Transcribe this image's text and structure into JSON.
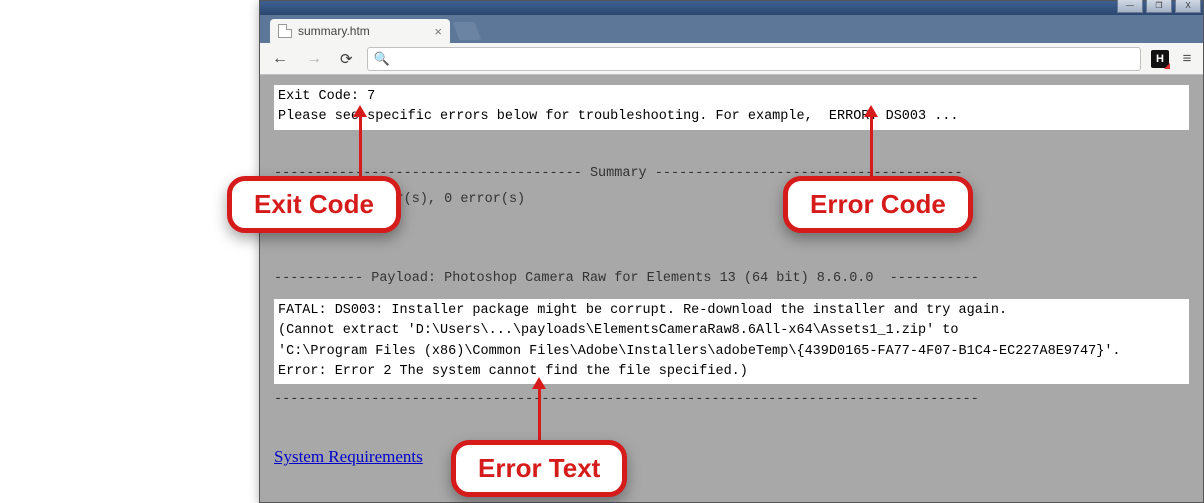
{
  "window": {
    "minimize": "—",
    "maximize": "❐",
    "close": "X"
  },
  "tab": {
    "title": "summary.htm",
    "close": "×"
  },
  "toolbar": {
    "back": "←",
    "forward": "→",
    "reload": "⟳",
    "search_icon": "🔍",
    "omnibox_value": "",
    "ext_label": "H",
    "menu": "≡"
  },
  "content": {
    "exit_line": "Exit Code: 7",
    "advice_line": "Please see specific errors below for troubleshooting. For example,  ERROR: DS003 ...",
    "blank_gap1": " ",
    "summary_sep": "-------------------------------------- Summary --------------------------------------",
    "counts_line": " - 2 fatal error(s), 0 error(s)",
    "blank_gap2": " ",
    "blank_gap3": " ",
    "payload_sep": "----------- Payload: Photoshop Camera Raw for Elements 13 (64 bit) 8.6.0.0  -----------",
    "fatal1": "FATAL: DS003: Installer package might be corrupt. Re-download the installer and try again.",
    "fatal2": "(Cannot extract 'D:\\Users\\...\\payloads\\ElementsCameraRaw8.6All-x64\\Assets1_1.zip' to",
    "fatal3": "'C:\\Program Files (x86)\\Common Files\\Adobe\\Installers\\adobeTemp\\{439D0165-FA77-4F07-B1C4-EC227A8E9747}'.",
    "fatal4": "Error: Error 2 The system cannot find the file specified.)",
    "end_sep": "---------------------------------------------------------------------------------------",
    "link_text": "System Requirements"
  },
  "callouts": {
    "exit_code": "Exit Code",
    "error_code": "Error Code",
    "error_text": "Error Text"
  }
}
